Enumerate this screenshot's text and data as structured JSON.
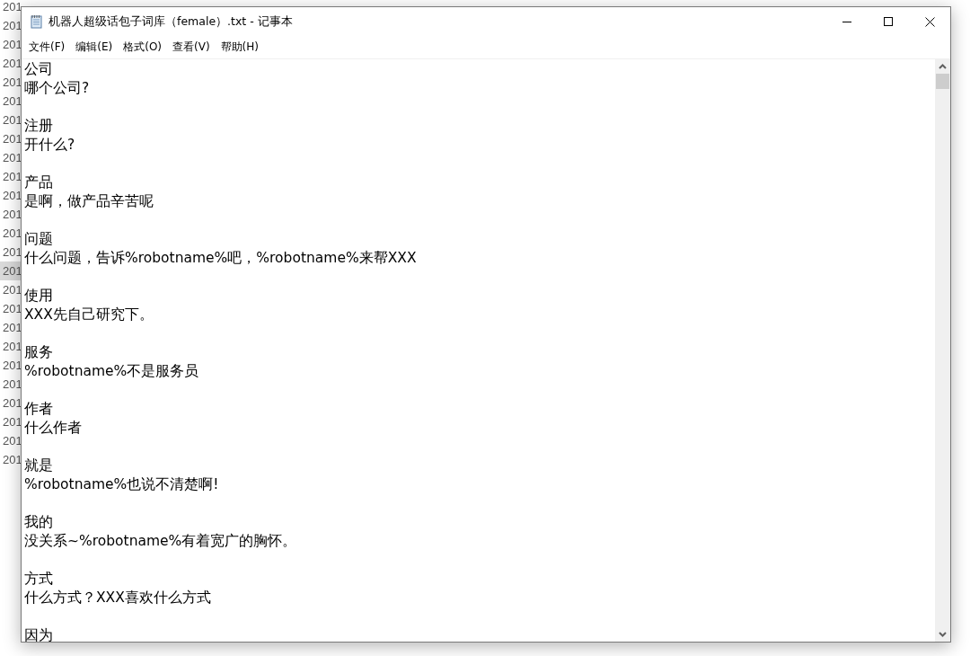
{
  "background_list": {
    "rows": [
      {
        "text": "201",
        "selected": false
      },
      {
        "text": "201",
        "selected": false
      },
      {
        "text": "201",
        "selected": false
      },
      {
        "text": "201",
        "selected": false
      },
      {
        "text": "201",
        "selected": false
      },
      {
        "text": "201",
        "selected": false
      },
      {
        "text": "201",
        "selected": false
      },
      {
        "text": "201",
        "selected": false
      },
      {
        "text": "201",
        "selected": false
      },
      {
        "text": "201",
        "selected": false
      },
      {
        "text": "201",
        "selected": false
      },
      {
        "text": "201",
        "selected": false
      },
      {
        "text": "201",
        "selected": false
      },
      {
        "text": "201",
        "selected": false
      },
      {
        "text": "201",
        "selected": true
      },
      {
        "text": "201",
        "selected": false
      },
      {
        "text": "201",
        "selected": false
      },
      {
        "text": "201",
        "selected": false
      },
      {
        "text": "201",
        "selected": false
      },
      {
        "text": "201",
        "selected": false
      },
      {
        "text": "201",
        "selected": false
      },
      {
        "text": "201",
        "selected": false
      },
      {
        "text": "201",
        "selected": false
      },
      {
        "text": "201",
        "selected": false
      },
      {
        "text": "201",
        "selected": false
      }
    ]
  },
  "window": {
    "title": "机器人超级话包子词库（female）.txt - 记事本"
  },
  "menu": [
    "文件(F)",
    "编辑(E)",
    "格式(O)",
    "查看(V)",
    "帮助(H)"
  ],
  "document": {
    "entries": [
      {
        "keyword": "公司",
        "reply": "哪个公司?"
      },
      {
        "keyword": "注册",
        "reply": "开什么?"
      },
      {
        "keyword": "产品",
        "reply": "是啊，做产品辛苦呢"
      },
      {
        "keyword": "问题",
        "reply": "什么问题，告诉%robotname%吧，%robotname%来帮XXX"
      },
      {
        "keyword": "使用",
        "reply": "XXX先自己研究下。"
      },
      {
        "keyword": "服务",
        "reply": "%robotname%不是服务员"
      },
      {
        "keyword": "作者",
        "reply": "什么作者"
      },
      {
        "keyword": "就是",
        "reply": "%robotname%也说不清楚啊!"
      },
      {
        "keyword": "我的",
        "reply": "没关系~%robotname%有着宽广的胸怀。"
      },
      {
        "keyword": "方式",
        "reply": "什么方式？XXX喜欢什么方式"
      },
      {
        "keyword": "因为"
      }
    ]
  }
}
